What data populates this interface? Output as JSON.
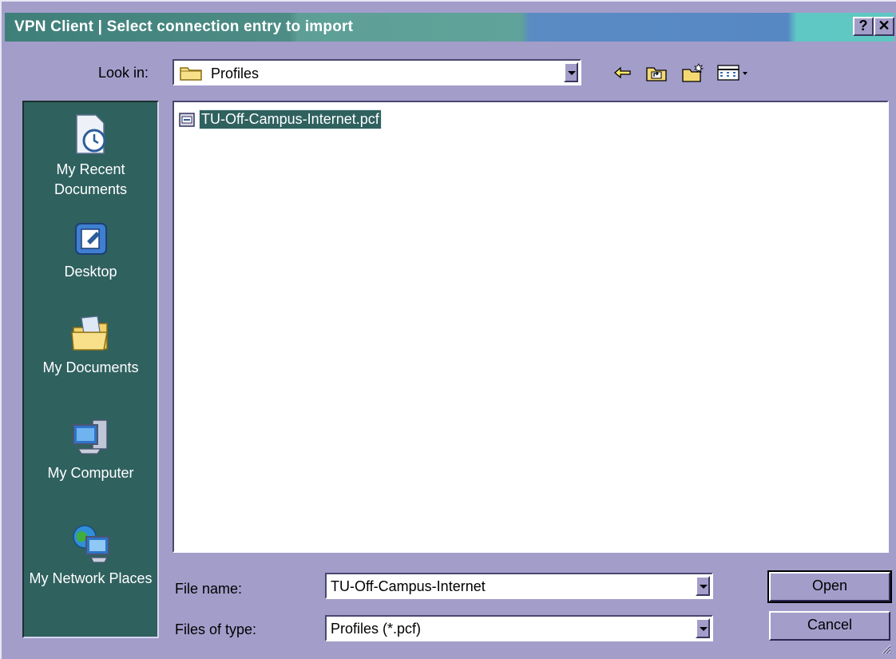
{
  "window": {
    "title": "VPN Client  |  Select connection entry to import",
    "help_button": "?",
    "close_button": "✕"
  },
  "toolbar": {
    "look_in_label": "Look in:",
    "look_in_value": "Profiles",
    "icons": [
      "back-arrow-icon",
      "up-one-level-icon",
      "new-folder-icon",
      "view-menu-icon"
    ]
  },
  "places_bar": {
    "items": [
      {
        "label": "My Recent Documents",
        "icon": "recent-documents-icon"
      },
      {
        "label": "Desktop",
        "icon": "desktop-icon"
      },
      {
        "label": "My Documents",
        "icon": "my-documents-icon"
      },
      {
        "label": "My Computer",
        "icon": "my-computer-icon"
      },
      {
        "label": "My Network Places",
        "icon": "network-places-icon"
      }
    ]
  },
  "file_list": {
    "items": [
      {
        "name": "TU-Off-Campus-Internet.pcf",
        "selected": true,
        "icon": "pcf-file-icon"
      }
    ]
  },
  "form": {
    "file_name_label": "File name:",
    "file_name_value": "TU-Off-Campus-Internet",
    "file_type_label": "Files of type:",
    "file_type_value": "Profiles (*.pcf)"
  },
  "buttons": {
    "open": "Open",
    "cancel": "Cancel"
  },
  "colors": {
    "dialog_bg": "#a39dca",
    "places_bg": "#2f615f",
    "selection_bg": "#2f615f",
    "title_gradient_start": "#3f7f7a",
    "title_gradient_end": "#5fc7c2"
  }
}
